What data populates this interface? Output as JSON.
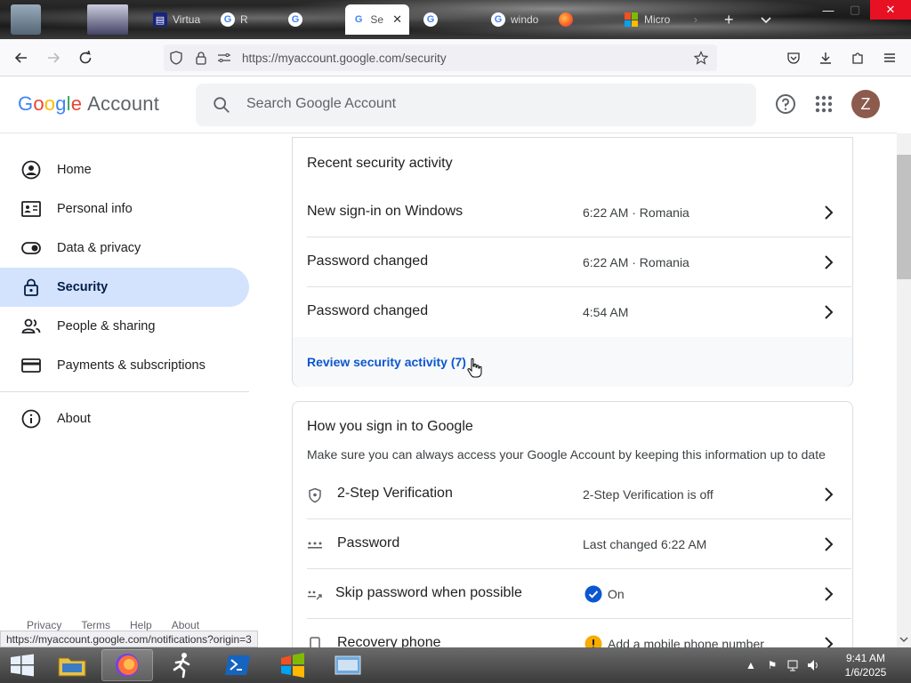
{
  "browser": {
    "tabs": [
      {
        "label": "Virtua",
        "active": false
      },
      {
        "label": "R",
        "active": false
      },
      {
        "label": "",
        "active": false
      },
      {
        "label": "Se",
        "active": true
      },
      {
        "label": "",
        "active": false
      },
      {
        "label": "windo",
        "active": false
      },
      {
        "label": "",
        "active": false
      },
      {
        "label": "Micro",
        "active": false
      }
    ],
    "new_tab": "+",
    "tab_list": "⌄",
    "url": "https://myaccount.google.com/security",
    "status_url": "https://myaccount.google.com/notifications?origin=3"
  },
  "header": {
    "logo_google": "Google",
    "logo_account": "Account",
    "search_placeholder": "Search Google Account",
    "avatar_letter": "Z"
  },
  "sidebar": {
    "items": [
      {
        "label": "Home",
        "icon": "home-icon",
        "active": false
      },
      {
        "label": "Personal info",
        "icon": "id-card-icon",
        "active": false
      },
      {
        "label": "Data & privacy",
        "icon": "toggle-icon",
        "active": false
      },
      {
        "label": "Security",
        "icon": "lock-icon",
        "active": true
      },
      {
        "label": "People & sharing",
        "icon": "people-icon",
        "active": false
      },
      {
        "label": "Payments & subscriptions",
        "icon": "card-icon",
        "active": false
      },
      {
        "label": "About",
        "icon": "info-icon",
        "active": false
      }
    ],
    "footer": [
      "Privacy",
      "Terms",
      "Help",
      "About"
    ]
  },
  "recent_activity": {
    "title": "Recent security activity",
    "rows": [
      {
        "label": "New sign-in on Windows",
        "value": "6:22 AM · Romania"
      },
      {
        "label": "Password changed",
        "value": "6:22 AM · Romania"
      },
      {
        "label": "Password changed",
        "value": "4:54 AM"
      }
    ],
    "review_link": "Review security activity (7)"
  },
  "signin": {
    "title": "How you sign in to Google",
    "description": "Make sure you can always access your Google Account by keeping this information up to date",
    "rows": [
      {
        "label": "2-Step Verification",
        "value": "2-Step Verification is off",
        "icon": "shield-icon"
      },
      {
        "label": "Password",
        "value": "Last changed 6:22 AM",
        "icon": "password-dots-icon"
      },
      {
        "label": "Skip password when possible",
        "value": "On",
        "icon": "passkey-icon"
      },
      {
        "label": "Recovery phone",
        "value": "Add a mobile phone number",
        "icon": "phone-icon"
      }
    ]
  },
  "taskbar": {
    "time": "9:41 AM",
    "date": "1/6/2025"
  },
  "colors": {
    "active_nav": "#d3e3fd",
    "link": "#0b57d0",
    "close_red": "#e81123",
    "google_blue": "#4285f4",
    "google_red": "#ea4335",
    "google_yellow": "#fbbc05",
    "google_green": "#34a853"
  }
}
